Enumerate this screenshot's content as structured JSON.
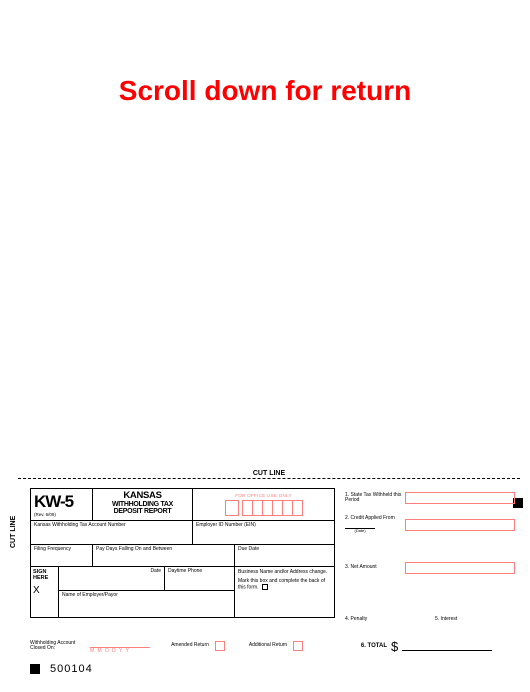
{
  "scroll_message": "Scroll down for return",
  "cut_line": "CUT LINE",
  "side_cut": "CUT LINE",
  "form": {
    "code": "KW-5",
    "rev": "(Rev. 6/09)",
    "state": "KANSAS",
    "title_line1": "WITHHOLDING TAX",
    "title_line2": "DEPOSIT REPORT",
    "office_use": "FOR OFFICE USE ONLY",
    "acct_label": "Kansas Withholding Tax Account Number",
    "ein_label": "Employer ID Number (EIN)",
    "filing_freq": "Filing Frequency",
    "pay_days": "Pay Days Falling On and Between",
    "due_date": "Due Date",
    "sign_here": "SIGN HERE",
    "x": "X",
    "date": "Date",
    "daytime_phone": "Daytime Phone",
    "employer_name": "Name of Employer/Payor",
    "addr_line1": "Business Name and/or Address change.",
    "addr_line2": "Mark this box and complete the back of this form."
  },
  "right": {
    "l1": "1. State Tax Withheld this Period",
    "l2": "2. Credit Applied From",
    "l2_date": "(Date)",
    "l3": "3. Net Amount",
    "l4": "4. Penalty",
    "l5": "5. Interest"
  },
  "bottom": {
    "closed_label": "Withholding Account Closed On:",
    "date_fmt": "M M D D Y Y",
    "amended": "Amended Return",
    "additional": "Additional Return",
    "total": "6. TOTAL",
    "dollar": "$",
    "code": "500104"
  }
}
